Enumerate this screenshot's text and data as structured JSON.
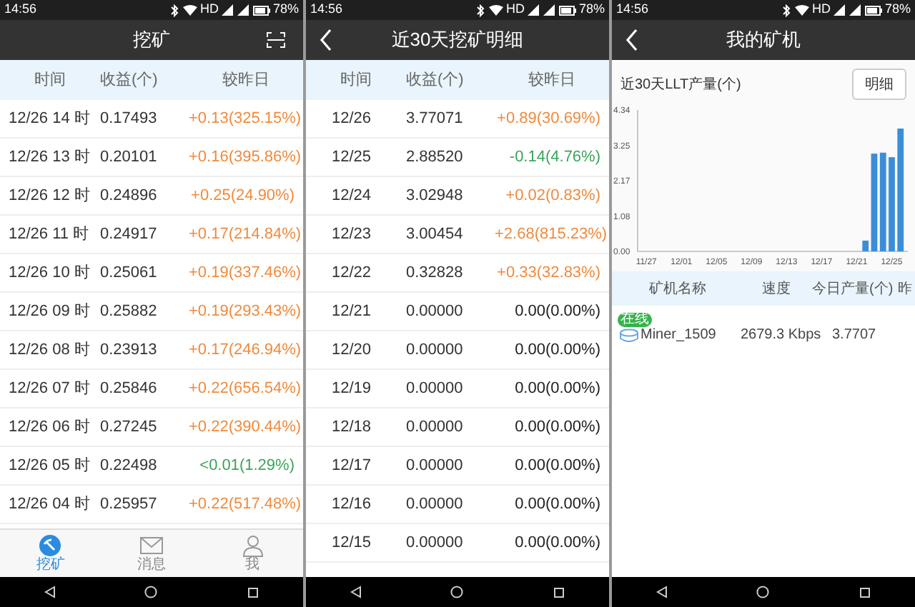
{
  "panels": [
    {
      "kind": "hourly",
      "status_bar": {
        "time": "14:56",
        "network": "HD",
        "battery": "78%"
      },
      "title": "挖矿",
      "columns": [
        "时间",
        "收益(个)",
        "较昨日"
      ],
      "rows": [
        {
          "time": "12/26 14 时",
          "income": "0.17493",
          "change": "+0.13(325.15%)",
          "color": "#f08a3c"
        },
        {
          "time": "12/26 13 时",
          "income": "0.20101",
          "change": "+0.16(395.86%)",
          "color": "#f08a3c"
        },
        {
          "time": "12/26 12 时",
          "income": "0.24896",
          "change": "+0.25(24.90%)",
          "color": "#f08a3c"
        },
        {
          "time": "12/26 11 时",
          "income": "0.24917",
          "change": "+0.17(214.84%)",
          "color": "#f08a3c"
        },
        {
          "time": "12/26 10 时",
          "income": "0.25061",
          "change": "+0.19(337.46%)",
          "color": "#f08a3c"
        },
        {
          "time": "12/26 09 时",
          "income": "0.25882",
          "change": "+0.19(293.43%)",
          "color": "#f08a3c"
        },
        {
          "time": "12/26 08 时",
          "income": "0.23913",
          "change": "+0.17(246.94%)",
          "color": "#f08a3c"
        },
        {
          "time": "12/26 07 时",
          "income": "0.25846",
          "change": "+0.22(656.54%)",
          "color": "#f08a3c"
        },
        {
          "time": "12/26 06 时",
          "income": "0.27245",
          "change": "+0.22(390.44%)",
          "color": "#f08a3c"
        },
        {
          "time": "12/26 05 时",
          "income": "0.22498",
          "change": "<0.01(1.29%)",
          "color": "#3aa55a"
        },
        {
          "time": "12/26 04 时",
          "income": "0.25957",
          "change": "+0.22(517.48%)",
          "color": "#f08a3c"
        }
      ],
      "tabs": [
        {
          "label": "挖矿",
          "selected": true
        },
        {
          "label": "消息",
          "selected": false
        },
        {
          "label": "我",
          "selected": false
        }
      ]
    },
    {
      "kind": "daily",
      "status_bar": {
        "time": "14:56",
        "network": "HD",
        "battery": "78%"
      },
      "title": "近30天挖矿明细",
      "columns": [
        "时间",
        "收益(个)",
        "较昨日"
      ],
      "rows": [
        {
          "time": "12/26",
          "income": "3.77071",
          "change": "+0.89(30.69%)",
          "color": "#f08a3c"
        },
        {
          "time": "12/25",
          "income": "2.88520",
          "change": "-0.14(4.76%)",
          "color": "#3aa55a"
        },
        {
          "time": "12/24",
          "income": "3.02948",
          "change": "+0.02(0.83%)",
          "color": "#f08a3c"
        },
        {
          "time": "12/23",
          "income": "3.00454",
          "change": "+2.68(815.23%)",
          "color": "#f08a3c"
        },
        {
          "time": "12/22",
          "income": "0.32828",
          "change": "+0.33(32.83%)",
          "color": "#f08a3c"
        },
        {
          "time": "12/21",
          "income": "0.00000",
          "change": "0.00(0.00%)",
          "color": "#222222"
        },
        {
          "time": "12/20",
          "income": "0.00000",
          "change": "0.00(0.00%)",
          "color": "#222222"
        },
        {
          "time": "12/19",
          "income": "0.00000",
          "change": "0.00(0.00%)",
          "color": "#222222"
        },
        {
          "time": "12/18",
          "income": "0.00000",
          "change": "0.00(0.00%)",
          "color": "#222222"
        },
        {
          "time": "12/17",
          "income": "0.00000",
          "change": "0.00(0.00%)",
          "color": "#222222"
        },
        {
          "time": "12/16",
          "income": "0.00000",
          "change": "0.00(0.00%)",
          "color": "#222222"
        },
        {
          "time": "12/15",
          "income": "0.00000",
          "change": "0.00(0.00%)",
          "color": "#222222"
        }
      ]
    },
    {
      "kind": "miners",
      "status_bar": {
        "time": "14:56",
        "network": "HD",
        "battery": "78%"
      },
      "title": "我的矿机",
      "chart_title": "近30天LLT产量(个)",
      "detail_button": "明细",
      "chart_data": {
        "type": "bar",
        "categories": [
          "11/27",
          null,
          null,
          null,
          "12/01",
          null,
          null,
          null,
          "12/05",
          null,
          null,
          null,
          "12/09",
          null,
          null,
          null,
          "12/13",
          null,
          null,
          null,
          "12/17",
          null,
          null,
          null,
          "12/21",
          null,
          null,
          null,
          "12/25",
          null
        ],
        "series": [
          {
            "color": "#3b8dd8",
            "values": [
              0,
              0,
              0,
              0,
              0,
              0,
              0,
              0,
              0,
              0,
              0,
              0,
              0,
              0,
              0,
              0,
              0,
              0,
              0,
              0,
              0,
              0,
              0,
              0,
              0,
              0.33,
              3.0,
              3.03,
              2.89,
              3.77
            ]
          }
        ],
        "ylim": [
          0,
          4.34
        ],
        "yticks": [
          {
            "value": 0,
            "label": "0.00"
          },
          {
            "value": 1.08,
            "label": "1.08"
          },
          {
            "value": 2.17,
            "label": "2.17"
          },
          {
            "value": 3.25,
            "label": "3.25"
          },
          {
            "value": 4.34,
            "label": "4.34"
          }
        ]
      },
      "columns": [
        "矿机名称",
        "速度",
        "今日产量(个)",
        "昨"
      ],
      "miners": [
        {
          "badge": "在线",
          "name": "Miner_1509",
          "speed": "2679.3 Kbps",
          "today": "3.7707"
        }
      ]
    }
  ]
}
